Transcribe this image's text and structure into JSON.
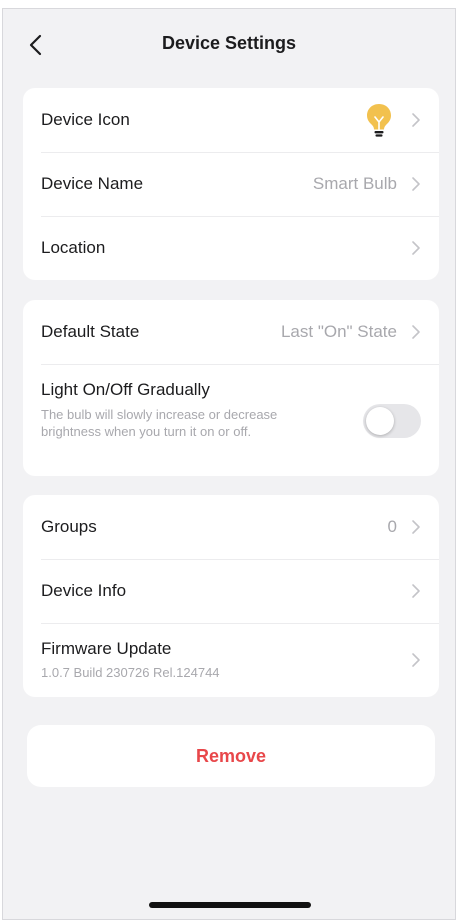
{
  "header": {
    "title": "Device Settings"
  },
  "section1": {
    "device_icon_label": "Device Icon",
    "device_name_label": "Device Name",
    "device_name_value": "Smart Bulb",
    "location_label": "Location"
  },
  "section2": {
    "default_state_label": "Default State",
    "default_state_value": "Last \"On\" State",
    "gradual_label": "Light On/Off Gradually",
    "gradual_desc": "The bulb will slowly increase or decrease brightness when you turn it on or off.",
    "gradual_enabled": false
  },
  "section3": {
    "groups_label": "Groups",
    "groups_value": "0",
    "device_info_label": "Device Info",
    "firmware_label": "Firmware Update",
    "firmware_version": "1.0.7 Build 230726 Rel.124744"
  },
  "remove_label": "Remove",
  "colors": {
    "bulb": "#f2c14e",
    "remove": "#e8474a",
    "toggle_off": "#e6e6e9"
  },
  "icons": {
    "back": "chevron-left-icon",
    "chevron": "chevron-right-icon",
    "device": "lightbulb-icon"
  }
}
